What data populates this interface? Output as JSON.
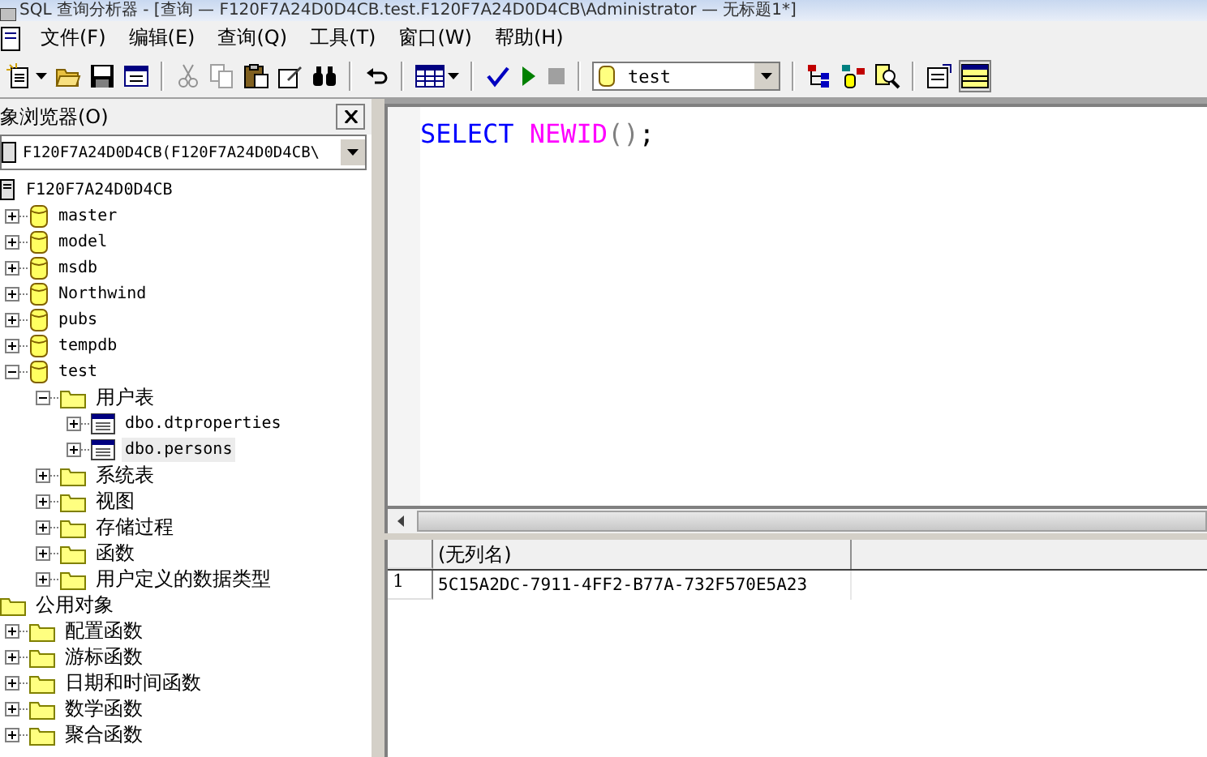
{
  "window": {
    "title": "SQL 查询分析器 - [查询 — F120F7A24D0D4CB.test.F120F7A24D0D4CB\\Administrator — 无标题1*]"
  },
  "menu": [
    "文件(F)",
    "编辑(E)",
    "查询(Q)",
    "工具(T)",
    "窗口(W)",
    "帮助(H)"
  ],
  "toolbar": {
    "database": "test"
  },
  "object_browser": {
    "title": "象浏览器(O)",
    "server_select": "F120F7A24D0D4CB(F120F7A24D0D4CB\\",
    "tree": [
      {
        "label": "F120F7A24D0D4CB",
        "kind": "server",
        "selected": false,
        "children": [
          {
            "label": "master",
            "kind": "database",
            "expanded": false,
            "selected": false
          },
          {
            "label": "model",
            "kind": "database",
            "expanded": false,
            "selected": false
          },
          {
            "label": "msdb",
            "kind": "database",
            "expanded": false,
            "selected": false
          },
          {
            "label": "Northwind",
            "kind": "database",
            "expanded": false,
            "selected": false
          },
          {
            "label": "pubs",
            "kind": "database",
            "expanded": false,
            "selected": false
          },
          {
            "label": "tempdb",
            "kind": "database",
            "expanded": false,
            "selected": false
          },
          {
            "label": "test",
            "kind": "database",
            "expanded": true,
            "selected": false,
            "children": [
              {
                "label": "用户表",
                "kind": "folder",
                "expanded": true,
                "selected": false,
                "children": [
                  {
                    "label": "dbo.dtproperties",
                    "kind": "table",
                    "expanded": false,
                    "selected": false
                  },
                  {
                    "label": "dbo.persons",
                    "kind": "table",
                    "expanded": false,
                    "selected": true
                  }
                ]
              },
              {
                "label": "系统表",
                "kind": "folder",
                "expanded": false,
                "selected": false
              },
              {
                "label": "视图",
                "kind": "folder",
                "expanded": false,
                "selected": false
              },
              {
                "label": "存储过程",
                "kind": "folder",
                "expanded": false,
                "selected": false
              },
              {
                "label": "函数",
                "kind": "folder",
                "expanded": false,
                "selected": false
              },
              {
                "label": "用户定义的数据类型",
                "kind": "folder",
                "expanded": false,
                "selected": false
              }
            ]
          }
        ]
      },
      {
        "label": "公用对象",
        "kind": "folder",
        "selected": false,
        "children": [
          {
            "label": "配置函数",
            "kind": "folder",
            "expanded": false,
            "selected": false
          },
          {
            "label": "游标函数",
            "kind": "folder",
            "expanded": false,
            "selected": false
          },
          {
            "label": "日期和时间函数",
            "kind": "folder",
            "expanded": false,
            "selected": false
          },
          {
            "label": "数学函数",
            "kind": "folder",
            "expanded": false,
            "selected": false
          },
          {
            "label": "聚合函数",
            "kind": "folder",
            "expanded": false,
            "selected": false
          }
        ]
      }
    ]
  },
  "editor": {
    "tokens": [
      {
        "text": "SELECT",
        "kind": "keyword"
      },
      {
        "text": "NEWID",
        "kind": "function"
      },
      {
        "text": "()",
        "kind": "operator"
      },
      {
        "text": ";",
        "kind": "plain"
      }
    ]
  },
  "results": {
    "columns": [
      "(无列名)"
    ],
    "rows": [
      {
        "number": "1",
        "cells": [
          "5C15A2DC-7911-4FF2-B77A-732F570E5A23"
        ]
      }
    ]
  }
}
